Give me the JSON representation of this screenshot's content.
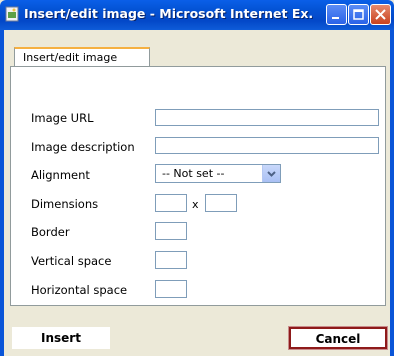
{
  "window": {
    "title": "Insert/edit image - Microsoft Internet Ex...",
    "controls": [
      "minimize",
      "maximize",
      "close"
    ]
  },
  "tab": {
    "label": "Insert/edit image"
  },
  "form": {
    "image_url_label": "Image URL",
    "image_description_label": "Image description",
    "alignment_label": "Alignment",
    "alignment_value": "-- Not set --",
    "dimensions_label": "Dimensions",
    "dimensions_separator": "x",
    "border_label": "Border",
    "vertical_space_label": "Vertical space",
    "horizontal_space_label": "Horizontal space"
  },
  "buttons": {
    "insert_label": "Insert",
    "cancel_label": "Cancel"
  },
  "colors": {
    "titlebar": "#0454D6",
    "tab_accent": "#F5B041",
    "cancel_border": "#8E1A1A",
    "background": "#ECE9D8"
  }
}
